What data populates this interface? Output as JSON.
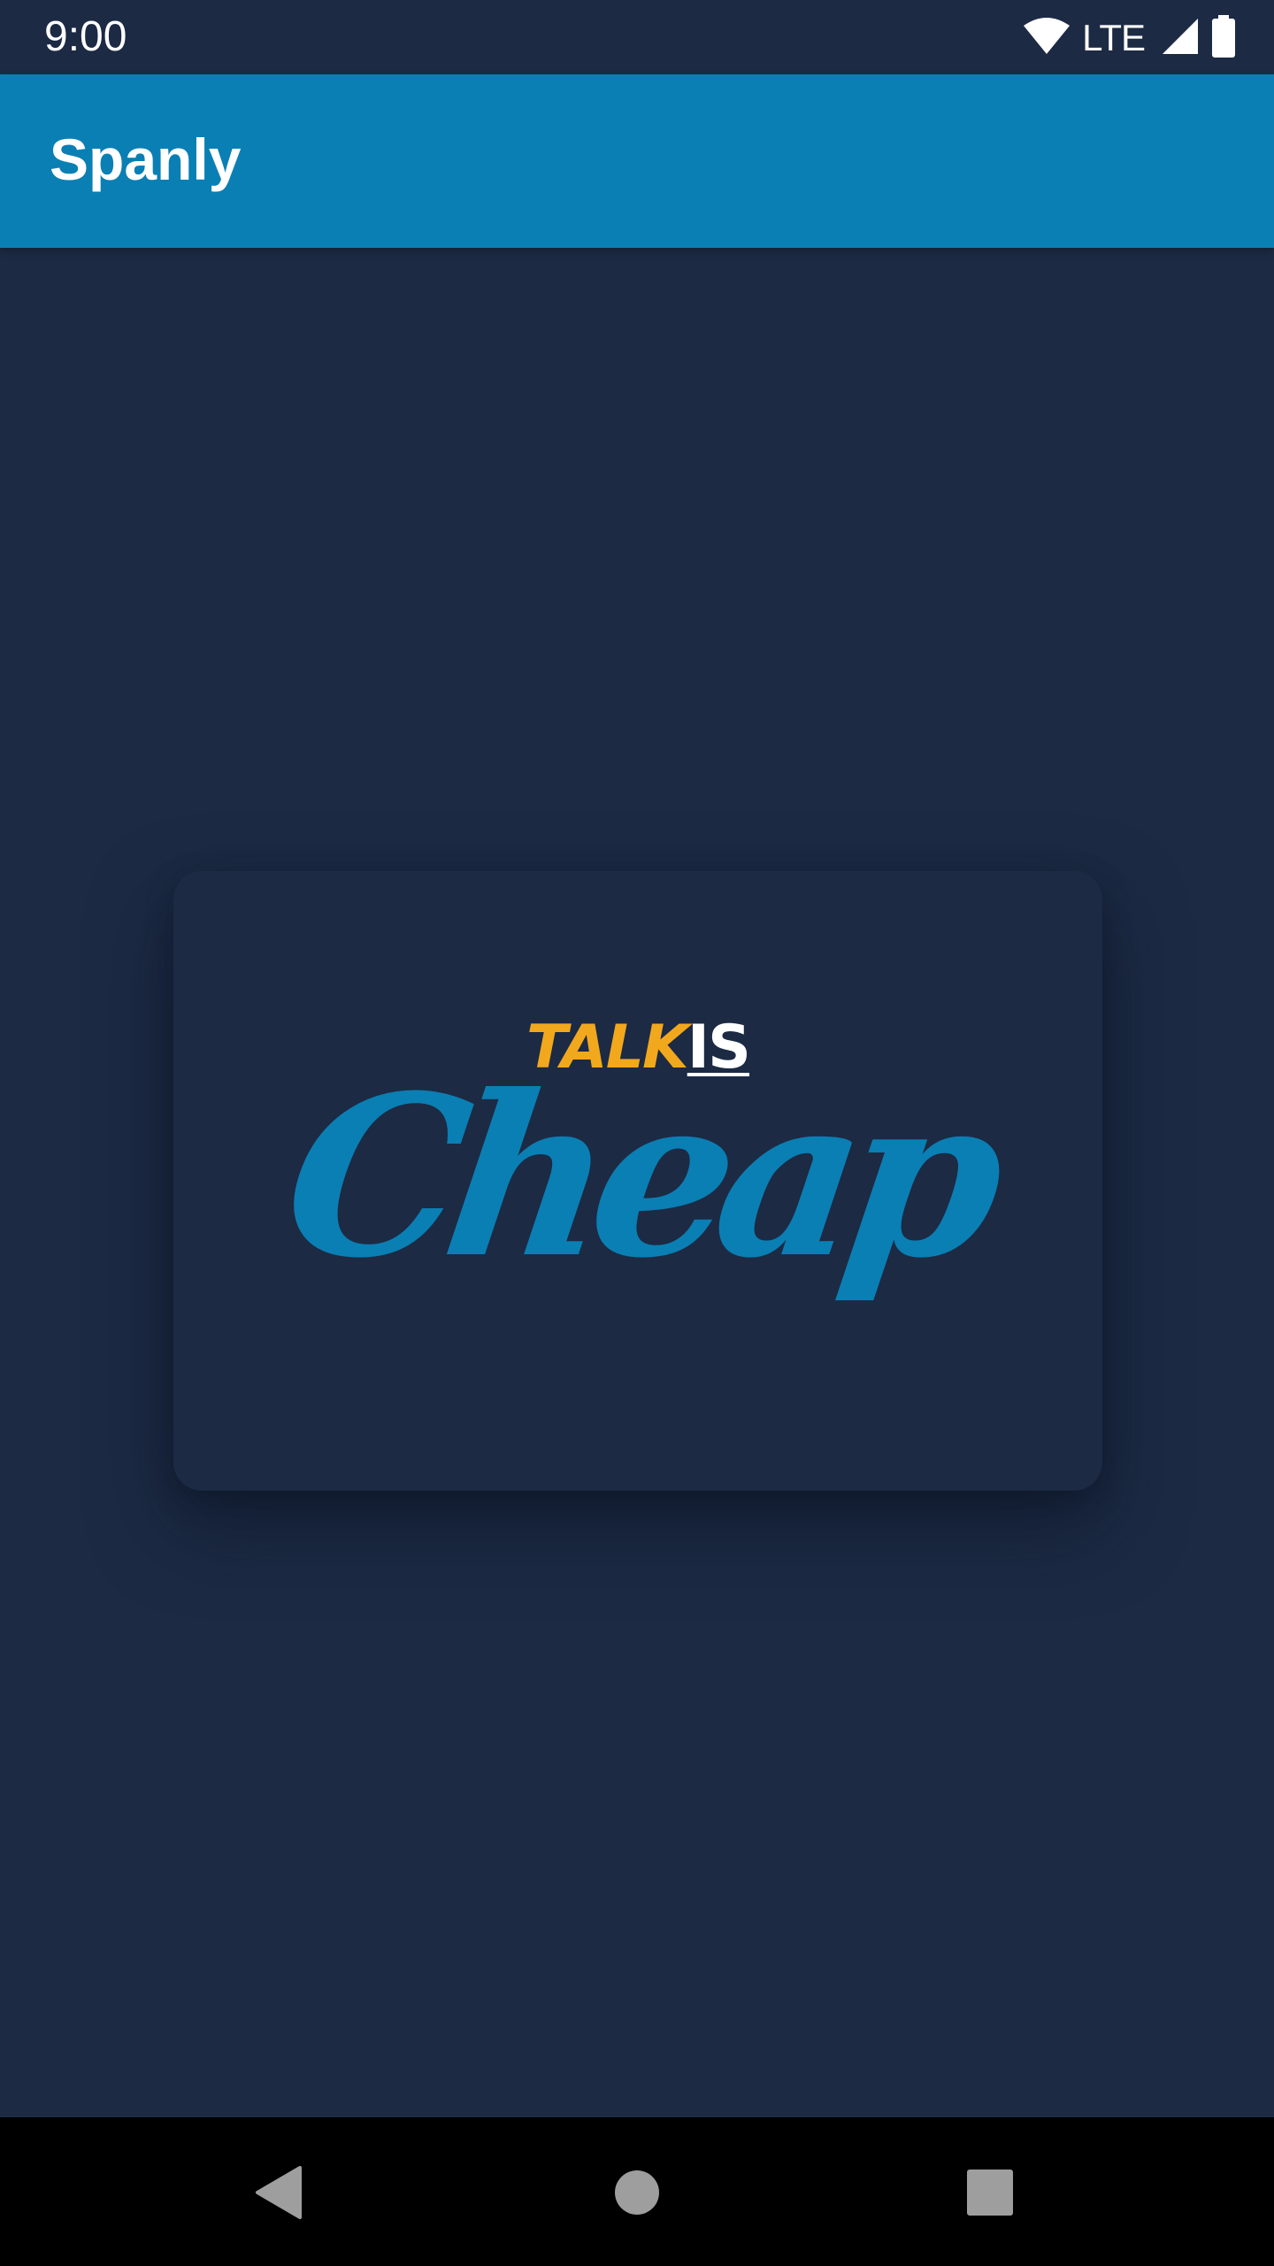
{
  "status_bar": {
    "time": "9:00",
    "network": "LTE",
    "icons": [
      "wifi-icon",
      "cell-signal-icon",
      "battery-icon"
    ]
  },
  "app_bar": {
    "title": "Spanly",
    "color": "#0a7fb4"
  },
  "content": {
    "logo": {
      "line1_part1": "TALK",
      "line1_part2": "IS",
      "line2": "Cheap",
      "colors": {
        "talk": "#f2a81d",
        "is": "#ffffff",
        "cheap": "#0a7fb4"
      }
    },
    "background": "#1c2a44"
  },
  "nav_bar": {
    "buttons": [
      "back-icon",
      "home-icon",
      "recents-icon"
    ]
  }
}
